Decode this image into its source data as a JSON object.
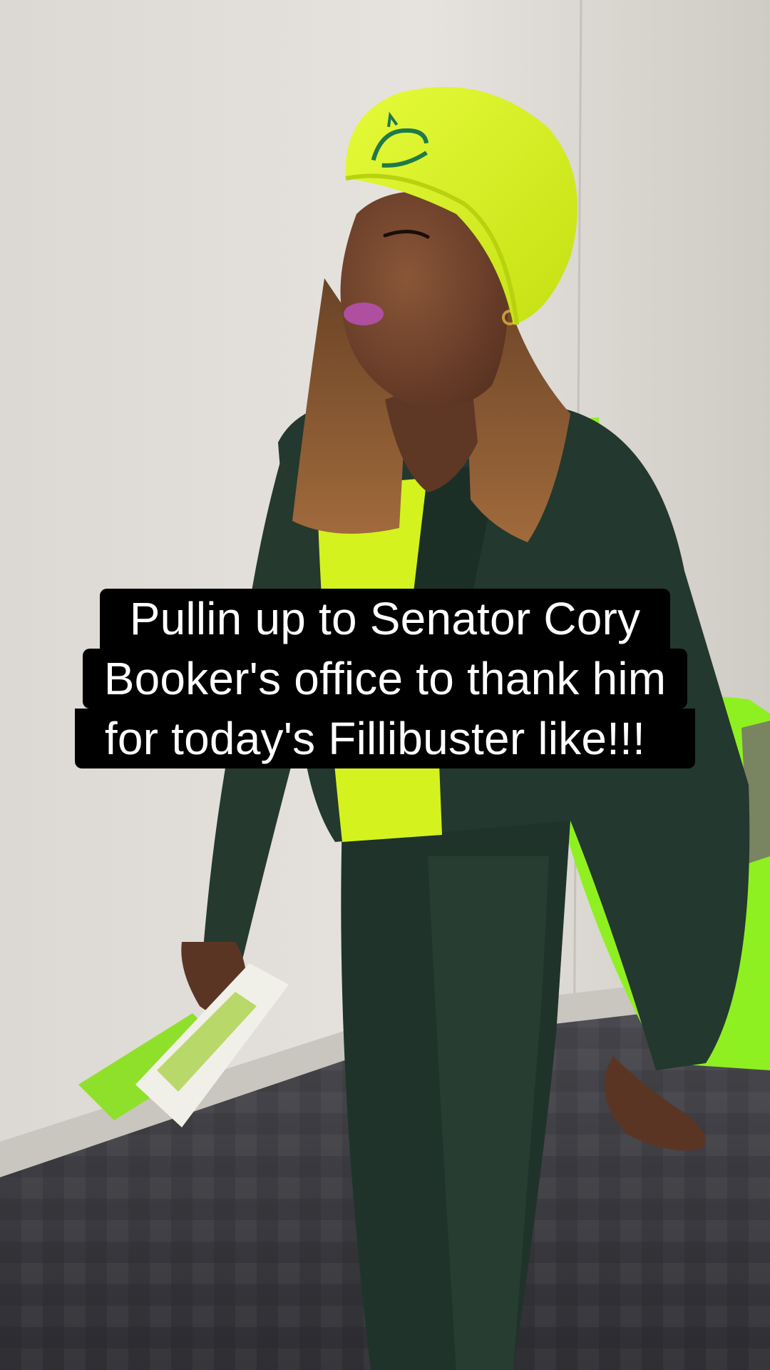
{
  "photo": {
    "subject": "woman in lime beret walking in hallway",
    "colors": {
      "wall": "#ddd9d4",
      "carpet": "#3a3a3e",
      "suit": "#23382e",
      "lime": "#d6f21f",
      "bag": "#8ff021",
      "skin": "#6b3f2c",
      "hair": "#8a5a33"
    }
  },
  "caption": {
    "line1": "Pullin up to Senator Cory",
    "line2": "Booker's office to thank him",
    "line3": "for today's Fillibuster like!!!"
  }
}
